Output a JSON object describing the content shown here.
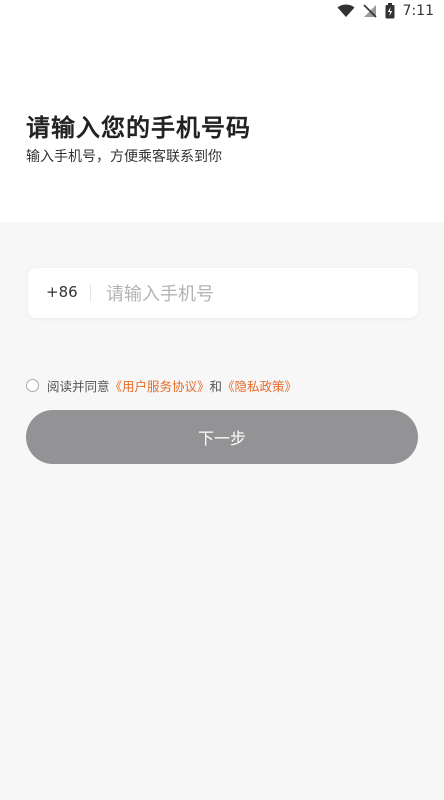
{
  "status_bar": {
    "time": "7:11",
    "icons": [
      "wifi-icon",
      "signal-off-icon",
      "battery-charging-icon"
    ]
  },
  "header": {
    "title": "请输入您的手机号码",
    "subtitle": "输入手机号，方便乘客联系到你"
  },
  "form": {
    "country_code": "+86",
    "phone_placeholder": "请输入手机号",
    "phone_value": ""
  },
  "agreement": {
    "prefix": "阅读并同意",
    "terms_link": "《用户服务协议》",
    "and": "和",
    "privacy_link": "《隐私政策》",
    "link_color": "#e66b2a",
    "checked": false
  },
  "actions": {
    "next_label": "下一步",
    "next_bg": "#939395"
  }
}
